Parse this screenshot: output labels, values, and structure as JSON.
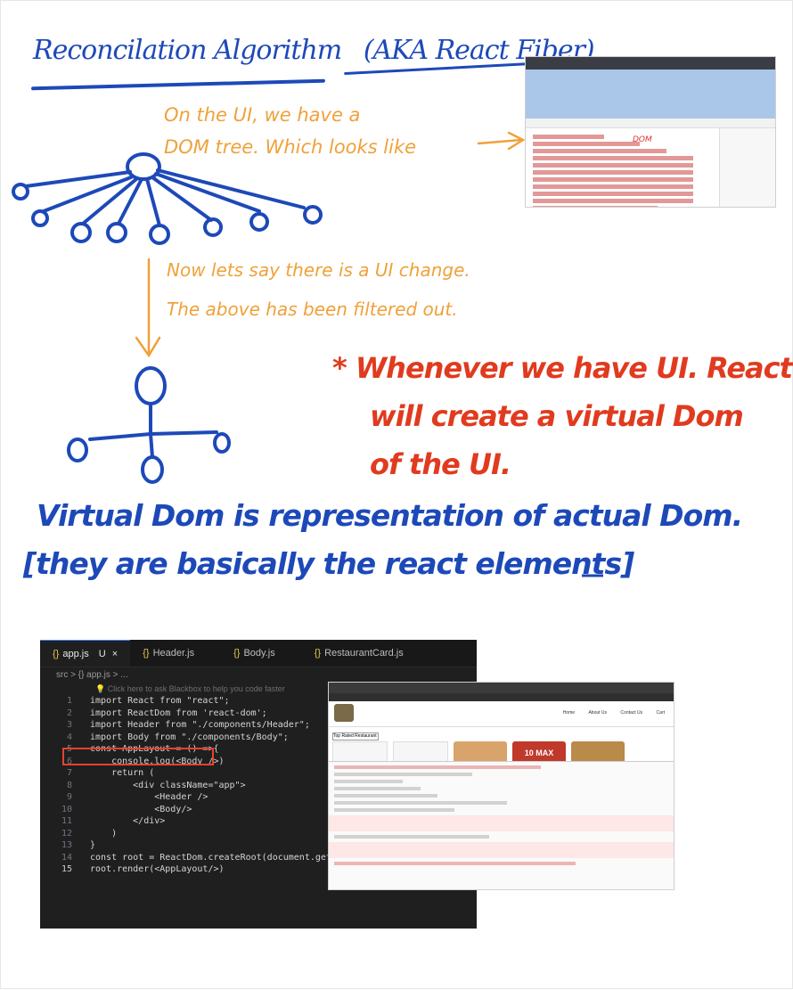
{
  "notes": {
    "title_a": "Reconcilation Algorithm",
    "title_b": "(AKA React Fiber)",
    "dom_line1": "On the UI, we have a",
    "dom_line2": "DOM tree. Which looks like",
    "change_line1": "Now lets say there is a UI change.",
    "change_line2": "The above has been filtered out.",
    "red_line1": "* Whenever we have UI. React",
    "red_line2": "will create a virtual Dom",
    "red_line3": "of the UI.",
    "vdom_line1": "Virtual Dom is representation of actual Dom.",
    "vdom_line2": "[they are basically the react elements]",
    "dom_arrow_label": "DOM"
  },
  "editor": {
    "tabs": [
      {
        "icon": "{}",
        "label": "app.js",
        "badge": "U",
        "close": "×"
      },
      {
        "icon": "{}",
        "label": "Header.js"
      },
      {
        "icon": "{}",
        "label": "Body.js"
      },
      {
        "icon": "{}",
        "label": "RestaurantCard.js"
      }
    ],
    "breadcrumb": "src > {} app.js > ...",
    "hint": "💡 Click here to ask Blackbox to help you code faster",
    "lines": [
      {
        "n": "1",
        "t": "import React from \"react\";"
      },
      {
        "n": "2",
        "t": "import ReactDom from 'react-dom';"
      },
      {
        "n": "3",
        "t": "import Header from \"./components/Header\";"
      },
      {
        "n": "4",
        "t": "import Body from \"./components/Body\";"
      },
      {
        "n": "5",
        "t": "const AppLayout = () =>{"
      },
      {
        "n": "6",
        "t": "    console.log(<Body />)"
      },
      {
        "n": "7",
        "t": "    return ("
      },
      {
        "n": "8",
        "t": "        <div className=\"app\">"
      },
      {
        "n": "9",
        "t": "            <Header />"
      },
      {
        "n": "10",
        "t": "            <Body/>"
      },
      {
        "n": "11",
        "t": "        </div>"
      },
      {
        "n": "12",
        "t": "    )"
      },
      {
        "n": "13",
        "t": "}"
      },
      {
        "n": "14",
        "t": "const root = ReactDom.createRoot(document.getElem"
      },
      {
        "n": "15",
        "t": "root.render(<AppLayout/>)"
      }
    ]
  },
  "browser": {
    "nav": [
      "Home",
      "About Us",
      "Contact Us",
      "Cart"
    ],
    "search_placeholder": "Top Rated Restaurant",
    "badge_text": "10 MAX"
  }
}
